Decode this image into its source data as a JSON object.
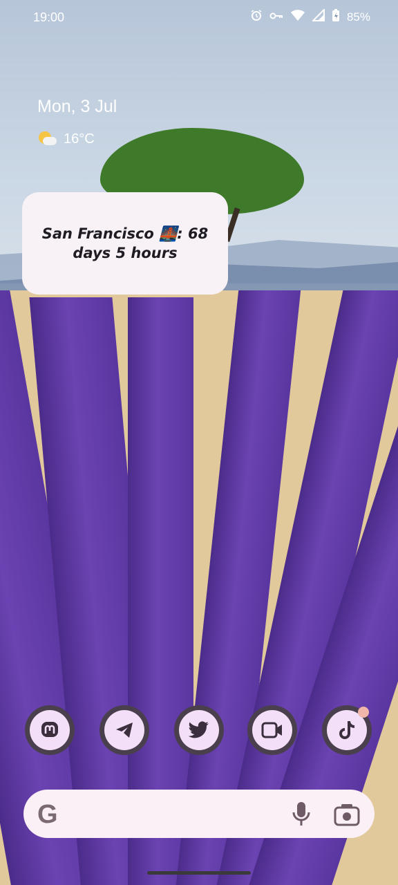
{
  "status_bar": {
    "time": "19:00",
    "battery_percent": "85%",
    "icons": [
      "alarm-icon",
      "vpn-key-icon",
      "wifi-icon",
      "signal-icon",
      "battery-icon"
    ]
  },
  "glance": {
    "date": "Mon, 3 Jul",
    "temperature": "16°C",
    "weather_icon": "partly-cloudy-icon"
  },
  "widget": {
    "text": "San Francisco 🌉: 68 days 5 hours"
  },
  "dock": {
    "apps": [
      {
        "name": "Mastodon",
        "icon": "mastodon-icon"
      },
      {
        "name": "Telegram",
        "icon": "telegram-icon"
      },
      {
        "name": "Twitter",
        "icon": "twitter-icon"
      },
      {
        "name": "Meet",
        "icon": "video-camera-icon"
      },
      {
        "name": "TikTok",
        "icon": "tiktok-icon"
      }
    ]
  },
  "search_bar": {
    "logo": "G",
    "icons": [
      "microphone-icon",
      "google-lens-icon"
    ]
  },
  "colors": {
    "widget_bg": "#f8f2f7",
    "dock_icon_bg": "#f3dff7",
    "dock_icon_ring": "#4a3f4d",
    "search_bg": "#fbf0f6",
    "notification_dot": "#f1b7aa"
  }
}
